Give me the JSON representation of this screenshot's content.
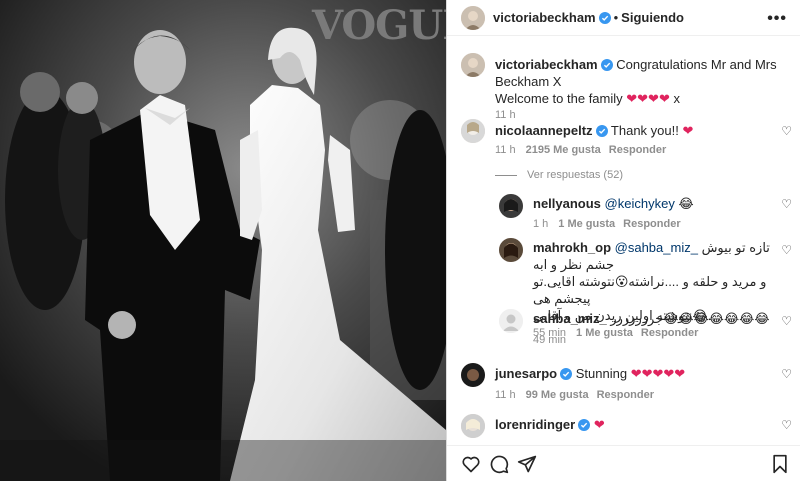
{
  "photo": {
    "brand": "VOGUE"
  },
  "header": {
    "username": "victoriabeckham",
    "separator": "•",
    "follow_label": "Siguiendo",
    "more": "•••"
  },
  "caption": {
    "username": "victoriabeckham",
    "text": "Congratulations Mr and Mrs Beckham X",
    "text2": "Welcome to the family",
    "hearts": "❤❤❤❤",
    "suffix": " x",
    "time": "11 h"
  },
  "comments": [
    {
      "username": "nicolaannepeltz",
      "text": "Thank you!!",
      "hearts": "❤",
      "time": "11 h",
      "likes": "2195 Me gusta",
      "reply": "Responder",
      "view_replies": "Ver respuestas (52)"
    },
    {
      "username": "nellyanous",
      "mention": "@keichykey",
      "emoji": "😂",
      "time": "1 h",
      "likes": "1 Me gusta",
      "reply": "Responder"
    },
    {
      "username": "mahrokh_op",
      "mention": "@sahba_miz_",
      "line1": "تازه تو بیوش جشم نظر و ابه",
      "line2": "و مرید و حلقه و ....نراشته😮نتوشته اقایی.تو پیجشم هی",
      "line3": "نتوشته اولین ریدن من و آقایی😂.",
      "time": "55 min",
      "likes": "1 Me gusta",
      "reply": "Responder"
    },
    {
      "username": "sahba_miz_",
      "text": "جررررررر",
      "emoji": "😂😂😂😂😂😂😂",
      "time": "49 min"
    },
    {
      "username": "junesarpo",
      "text": "Stunning",
      "hearts": "❤❤❤❤❤",
      "time": "11 h",
      "likes": "99 Me gusta",
      "reply": "Responder"
    },
    {
      "username": "lorenridinger",
      "hearts": "❤"
    }
  ],
  "icons": {
    "like": "heart-icon",
    "comment": "comment-icon",
    "share": "share-icon",
    "save": "bookmark-icon"
  }
}
